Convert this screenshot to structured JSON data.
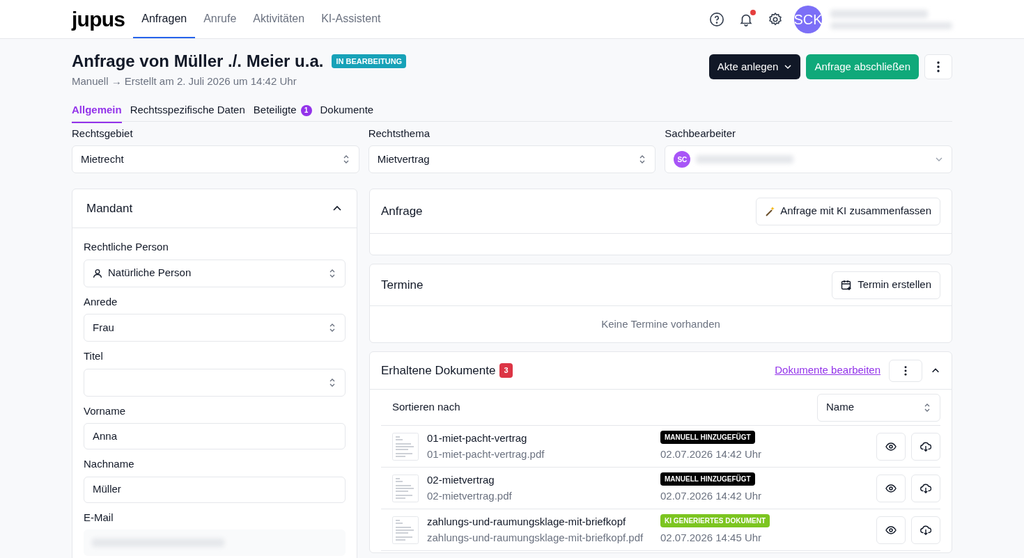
{
  "brand": "jupus",
  "nav": [
    {
      "label": "Anfragen",
      "selected": true
    },
    {
      "label": "Anrufe",
      "selected": false
    },
    {
      "label": "Aktivitäten",
      "selected": false
    },
    {
      "label": "KI-Assistent",
      "selected": false
    }
  ],
  "user": {
    "initials": "SCK",
    "notification": true
  },
  "title": "Anfrage von Müller ./. Meier u.a.",
  "status": "IN BEARBEITUNG",
  "subtitle": "Manuell → Erstellt am 2. Juli 2026 um 14:42 Uhr",
  "actions": {
    "primary": "Akte anlegen",
    "secondary": "Anfrage abschließen"
  },
  "tabs": [
    {
      "label": "Allgemein",
      "selected": true
    },
    {
      "label": "Rechtsspezifische Daten",
      "selected": false
    },
    {
      "label": "Beteiligte",
      "selected": false,
      "count": "1"
    },
    {
      "label": "Dokumente",
      "selected": false
    }
  ],
  "selects": [
    {
      "label": "Rechtsgebiet",
      "value": "Mietrecht"
    },
    {
      "label": "Rechtsthema",
      "value": "Mietvertrag"
    },
    {
      "label": "Sachbearbeiter",
      "avatar": "SC"
    }
  ],
  "mandant": {
    "title": "Mandant",
    "expanded": true,
    "fields": [
      {
        "label": "Rechtliche Person",
        "kind": "select",
        "value": "Natürliche Person",
        "person_icon": true
      },
      {
        "label": "Anrede",
        "kind": "select",
        "value": "Frau"
      },
      {
        "label": "Titel",
        "kind": "select"
      },
      {
        "label": "Vorname",
        "kind": "text",
        "value": "Anna"
      },
      {
        "label": "Nachname",
        "kind": "text",
        "value": "Müller"
      },
      {
        "label": "E-Mail",
        "kind": "text",
        "redacted": true
      }
    ]
  },
  "anfrage": {
    "title": "Anfrage",
    "button": "Anfrage mit KI zusammenfassen"
  },
  "termine": {
    "title": "Termine",
    "button": "Termin erstellen",
    "empty": "Keine Termine vorhanden"
  },
  "documents": {
    "title": "Erhaltene Dokumente",
    "count": "3",
    "edit_link": "Dokumente bearbeiten",
    "expanded": true,
    "sort_label": "Sortieren nach",
    "sort_value": "Name",
    "rows": [
      {
        "name": "01-miet-pacht-vertrag",
        "file": "01-miet-pacht-vertrag.pdf",
        "kind": "manual",
        "tag": "MANUELL HINZUGEFÜGT",
        "date": "02.07.2026 14:42 Uhr"
      },
      {
        "name": "02-mietvertrag",
        "file": "02-mietvertrag.pdf",
        "kind": "manual",
        "tag": "MANUELL HINZUGEFÜGT",
        "date": "02.07.2026 14:42 Uhr"
      },
      {
        "name": "zahlungs-und-raumungsklage-mit-briefkopf",
        "file": "zahlungs-und-raumungsklage-mit-briefkopf.pdf",
        "kind": "ai",
        "tag": "KI GENERIERTES DOKUMENT",
        "date": "02.07.2026 14:45 Uhr"
      }
    ]
  }
}
